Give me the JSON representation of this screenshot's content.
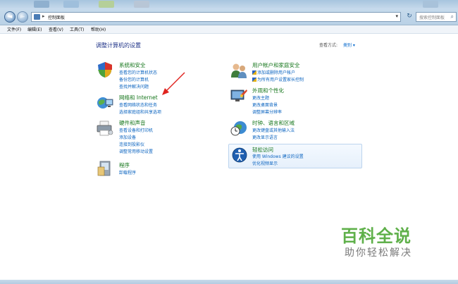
{
  "address": {
    "path": "控制面板",
    "separator": "▸",
    "search_placeholder": "搜索控制面板"
  },
  "menu": {
    "items": [
      "文件(F)",
      "编辑(E)",
      "查看(V)",
      "工具(T)",
      "帮助(H)"
    ]
  },
  "main": {
    "heading": "调整计算机的设置",
    "view_by_label": "查看方式:",
    "view_by_value": "类别 ▾"
  },
  "categories": {
    "system": {
      "title": "系统和安全",
      "links": [
        "查看您的计算机状态",
        "备份您的计算机",
        "查找并解决问题"
      ]
    },
    "network": {
      "title": "网络和 Internet",
      "links": [
        "查看网络状态和任务",
        "选择家庭组和共享选项"
      ]
    },
    "hardware": {
      "title": "硬件和声音",
      "links": [
        "查看设备和打印机",
        "添加设备",
        "连接到投影仪",
        "调整常用移动设置"
      ]
    },
    "programs": {
      "title": "程序",
      "links": [
        "卸载程序"
      ]
    },
    "users": {
      "title": "用户帐户和家庭安全",
      "links": [
        "添加或删除用户帐户",
        "为所有用户设置家长控制"
      ]
    },
    "appearance": {
      "title": "外观和个性化",
      "links": [
        "更改主题",
        "更改桌面背景",
        "调整屏幕分辨率"
      ]
    },
    "clock": {
      "title": "时钟、语言和区域",
      "links": [
        "更改键盘或其他输入法",
        "更改显示语言"
      ]
    },
    "ease": {
      "title": "轻松访问",
      "links": [
        "使用 Windows 建议的设置",
        "优化视频显示"
      ]
    }
  },
  "watermark": {
    "title": "百科全说",
    "subtitle": "助你轻松解决"
  },
  "colors": {
    "category_title": "#15761b",
    "link": "#0b64c0",
    "heading": "#1e3287",
    "arrow": "#e0231e"
  }
}
